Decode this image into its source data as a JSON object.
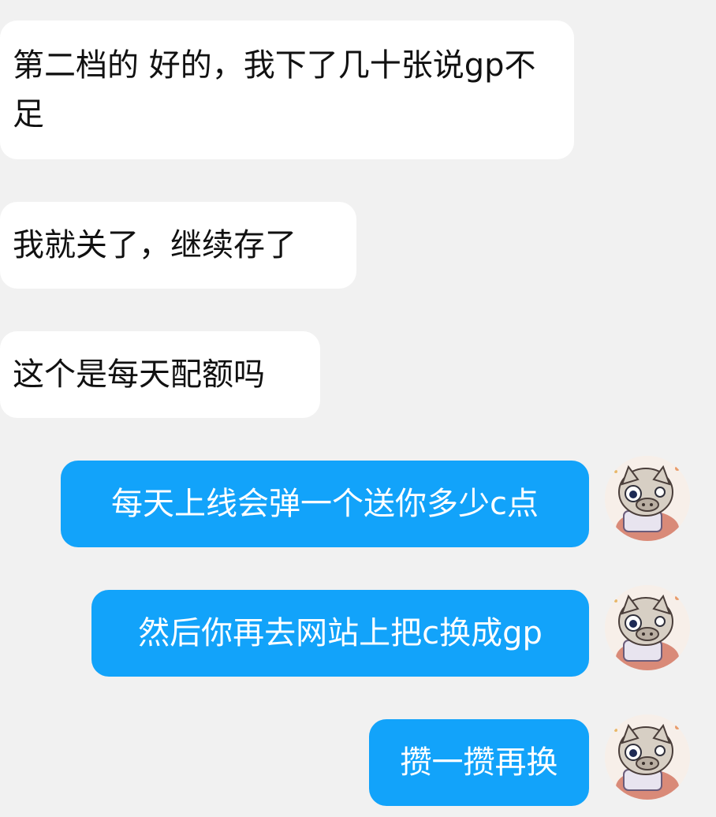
{
  "chat": {
    "messages": [
      {
        "id": "m1",
        "direction": "incoming",
        "text": "第二档的 好的，我下了几十张说gp不足"
      },
      {
        "id": "m2",
        "direction": "incoming",
        "text": "我就关了，继续存了"
      },
      {
        "id": "m3",
        "direction": "incoming",
        "text": "这个是每天配额吗"
      },
      {
        "id": "m4",
        "direction": "outgoing",
        "text": "每天上线会弹一个送你多少c点"
      },
      {
        "id": "m5",
        "direction": "outgoing",
        "text": "然后你再去网站上把c换成gp"
      },
      {
        "id": "m6",
        "direction": "outgoing",
        "text": "攒一攒再换"
      }
    ]
  },
  "colors": {
    "background": "#f1f1f1",
    "incoming_bubble": "#ffffff",
    "outgoing_bubble": "#12a3fa",
    "outgoing_text": "#ffffff"
  },
  "icons": {
    "avatar": "boar-mask-character-avatar"
  }
}
